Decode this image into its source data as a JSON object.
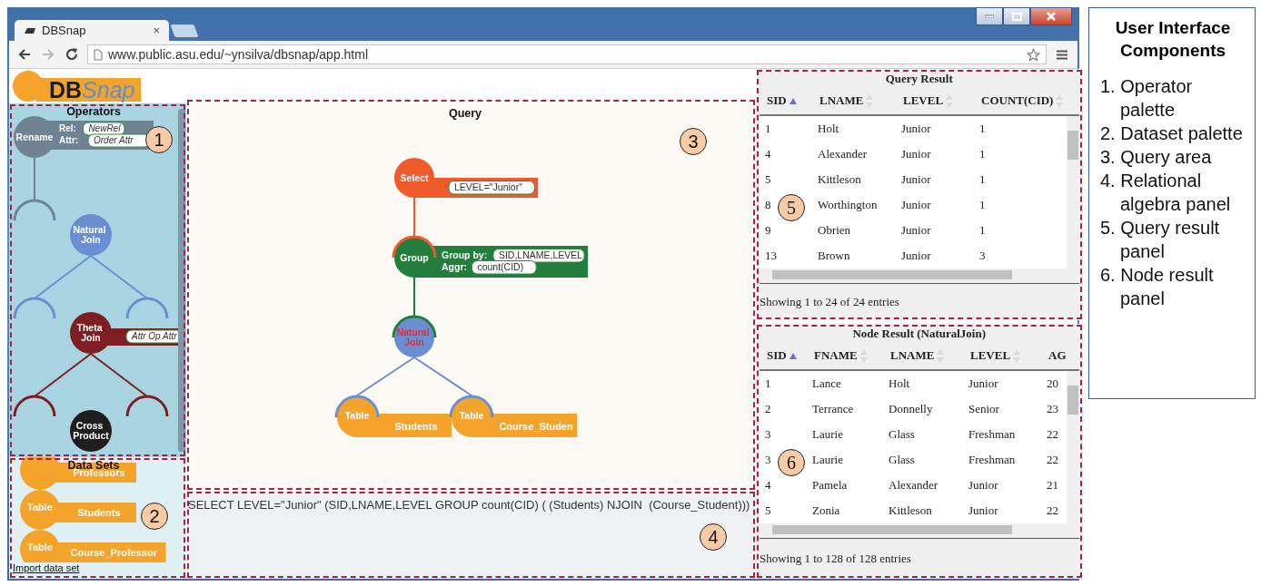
{
  "browser": {
    "tab_title": "DBSnap",
    "tab_close": "×",
    "address": "www.public.asu.edu/~ynsilva/dbsnap/app.html"
  },
  "logo": {
    "part_1": "DB",
    "part_2": "Snap"
  },
  "operators_panel": {
    "title": "Operators",
    "callout": "1",
    "operators": [
      {
        "kind": "rename",
        "label": "Rename",
        "color": "#6f8392",
        "params": [
          {
            "label": "Rel:",
            "placeholder": "NewRel"
          },
          {
            "label": "Attr:",
            "placeholder": "Order Attr"
          }
        ]
      },
      {
        "kind": "natural_join",
        "label": "Natural Join",
        "color": "#6a8fd0"
      },
      {
        "kind": "theta_join",
        "label": "Theta Join",
        "color": "#7d1f22",
        "params": [
          {
            "placeholder": "Attr Op Attr"
          }
        ]
      },
      {
        "kind": "cross_product",
        "label": "Cross Product",
        "color": "#1f1d1e"
      }
    ]
  },
  "datasets_panel": {
    "title": "Data Sets",
    "callout": "2",
    "datasets": [
      {
        "name": "Professors"
      },
      {
        "type_label": "Table",
        "name": "Students"
      },
      {
        "type_label": "Table",
        "name": "Course_Professor"
      }
    ],
    "import_link": "Import data set"
  },
  "query_area": {
    "title": "Query",
    "callout": "3",
    "tree": {
      "kind": "select",
      "label": "Select",
      "color": "#f15a2b",
      "selected": false,
      "params": [
        {
          "value": "LEVEL=\"Junior\""
        }
      ],
      "children": [
        {
          "kind": "group",
          "label": "Group",
          "color": "#237d3c",
          "selected": false,
          "params": [
            {
              "label": "Group by:",
              "value": "SID,LNAME,LEVEL"
            },
            {
              "label": "Aggr:",
              "value": "count(CID)"
            }
          ],
          "children": [
            {
              "kind": "natural_join",
              "label": "Natural Join",
              "color": "#6a8fd0",
              "selected": true,
              "children": [
                {
                  "kind": "table",
                  "label": "Table",
                  "name": "Students",
                  "color": "#f5a42b",
                  "selected": false
                },
                {
                  "kind": "table",
                  "label": "Table",
                  "name": "Course_Studen",
                  "color": "#f5a42b",
                  "selected": false
                }
              ]
            }
          ]
        }
      ]
    }
  },
  "algebra_panel": {
    "expression": "SELECT LEVEL=\"Junior\" (SID,LNAME,LEVEL GROUP count(CID) ( (Students) NJOIN  (Course_Student)))",
    "callout": "4"
  },
  "query_result": {
    "title": "Query Result",
    "callout": "5",
    "columns": [
      {
        "label": "SID",
        "sorted": true
      },
      {
        "label": "LNAME",
        "sorted": false
      },
      {
        "label": "LEVEL",
        "sorted": false
      },
      {
        "label": "COUNT(CID)",
        "sorted": false
      }
    ],
    "rows": [
      [
        "1",
        "Holt",
        "Junior",
        "1"
      ],
      [
        "4",
        "Alexander",
        "Junior",
        "1"
      ],
      [
        "5",
        "Kittleson",
        "Junior",
        "1"
      ],
      [
        "8",
        "Worthington",
        "Junior",
        "1"
      ],
      [
        "9",
        "Obrien",
        "Junior",
        "1"
      ],
      [
        "13",
        "Brown",
        "Junior",
        "3"
      ]
    ],
    "footer": "Showing 1 to 24 of 24 entries"
  },
  "node_result": {
    "title": "Node Result (NaturalJoin)",
    "callout": "6",
    "columns": [
      {
        "label": "SID",
        "sorted": true
      },
      {
        "label": "FNAME",
        "sorted": false
      },
      {
        "label": "LNAME",
        "sorted": false
      },
      {
        "label": "LEVEL",
        "sorted": false
      },
      {
        "label": "AG"
      }
    ],
    "rows": [
      [
        "1",
        "Lance",
        "Holt",
        "Junior",
        "20"
      ],
      [
        "2",
        "Terrance",
        "Donnelly",
        "Senior",
        "23"
      ],
      [
        "3",
        "Laurie",
        "Glass",
        "Freshman",
        "22"
      ],
      [
        "3",
        "Laurie",
        "Glass",
        "Freshman",
        "22"
      ],
      [
        "4",
        "Pamela",
        "Alexander",
        "Junior",
        "21"
      ],
      [
        "5",
        "Zonia",
        "Kittleson",
        "Junior",
        "22"
      ]
    ],
    "footer": "Showing 1 to 128 of 128 entries"
  },
  "legend": {
    "title": "User Interface Components",
    "items": [
      "1. Operator palette",
      "2. Dataset palette",
      "3. Query area",
      "4. Relational algebra panel",
      "5. Query result panel",
      "6. Node result panel"
    ]
  }
}
